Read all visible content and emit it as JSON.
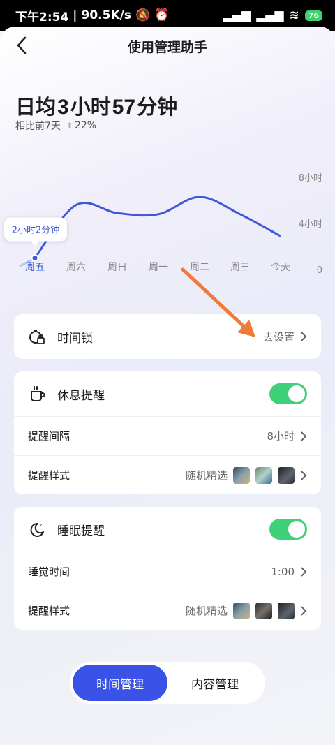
{
  "status": {
    "time": "下午2:54",
    "speed": "90.5K/s",
    "battery": "76"
  },
  "header": {
    "title": "使用管理助手"
  },
  "summary": {
    "prefix": "日均",
    "hours": "3",
    "hours_unit": "小时",
    "minutes": "57",
    "minutes_unit": "分钟",
    "compare_label": "相比前7天",
    "change": "22%"
  },
  "chart_data": {
    "type": "line",
    "categories": [
      "周五",
      "周六",
      "周日",
      "周一",
      "周二",
      "周三",
      "今天"
    ],
    "values": [
      1.0,
      5.6,
      4.9,
      4.8,
      6.3,
      4.8,
      2.9
    ],
    "ylim": [
      0,
      8
    ],
    "y_ticks": [
      "8小时",
      "4小时",
      "0"
    ],
    "tooltip": "2小时2分钟",
    "active_category": "周五"
  },
  "colors": {
    "accent": "#3a52e6",
    "line": "#4158d6",
    "toggle": "#3fd07a",
    "arrow": "#f07a3a"
  },
  "time_lock": {
    "label": "时间锁",
    "action": "去设置"
  },
  "rest_reminder": {
    "label": "休息提醒",
    "interval_label": "提醒间隔",
    "interval_value": "8小时",
    "style_label": "提醒样式",
    "style_value": "随机精选"
  },
  "sleep_reminder": {
    "label": "睡眠提醒",
    "time_label": "睡觉时间",
    "time_value": "1:00",
    "style_label": "提醒样式",
    "style_value": "随机精选"
  },
  "tabs": [
    {
      "label": "时间管理"
    },
    {
      "label": "内容管理"
    }
  ]
}
